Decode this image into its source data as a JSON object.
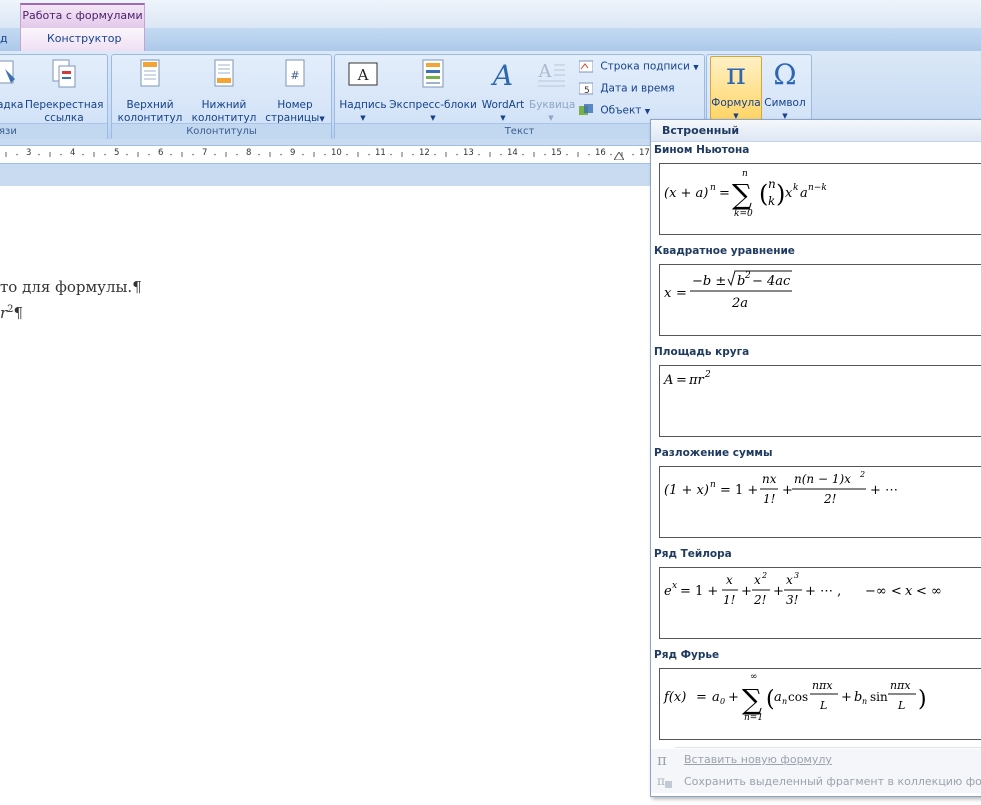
{
  "tabs": {
    "context_group": "Работа с формулами",
    "left_partial": "д",
    "constructor": "Конструктор"
  },
  "ribbon": {
    "links_group": {
      "partial_button": "адка",
      "cross_ref_line1": "Перекрестная",
      "cross_ref_line2": "ссылка",
      "label": "язи"
    },
    "headers_group": {
      "label": "Колонтитулы",
      "header_line1": "Верхний",
      "header_line2": "колонтитул",
      "footer_line1": "Нижний",
      "footer_line2": "колонтитул",
      "pagenum_line1": "Номер",
      "pagenum_line2": "страницы"
    },
    "text_group": {
      "label": "Текст",
      "textbox": "Надпись",
      "quickparts": "Экспресс-блоки",
      "wordart": "WordArt",
      "dropcap": "Буквица",
      "signature_line": "Строка подписи",
      "datetime": "Дата и время",
      "object": "Объект"
    },
    "symbols_group": {
      "formula": "Формула",
      "symbol": "Символ",
      "pi_glyph": "π",
      "omega_glyph": "Ω"
    }
  },
  "ruler": {
    "ticks": [
      "3",
      "4",
      "5",
      "6",
      "7",
      "8",
      "9",
      "10",
      "11",
      "12",
      "13",
      "14",
      "15",
      "16",
      "17"
    ]
  },
  "document": {
    "line1": "то для формулы.¶",
    "line2_base": "r",
    "line2_sup": "2",
    "line2_mark": "¶"
  },
  "gallery": {
    "header": "Встроенный",
    "items": [
      {
        "title": "Бином Ньютона"
      },
      {
        "title": "Квадратное уравнение"
      },
      {
        "title": "Площадь круга"
      },
      {
        "title": "Разложение суммы"
      },
      {
        "title": "Ряд Тейлора"
      },
      {
        "title": "Ряд Фурье"
      }
    ],
    "footer": {
      "insert_new": "Вставить новую формулу",
      "save_selection": "Сохранить выделенный фрагмент в коллекцию формул"
    }
  },
  "colors": {
    "ribbon_text": "#15428b",
    "context_tab": "#a26ab3",
    "formula_button_highlight": "#ffd566"
  }
}
